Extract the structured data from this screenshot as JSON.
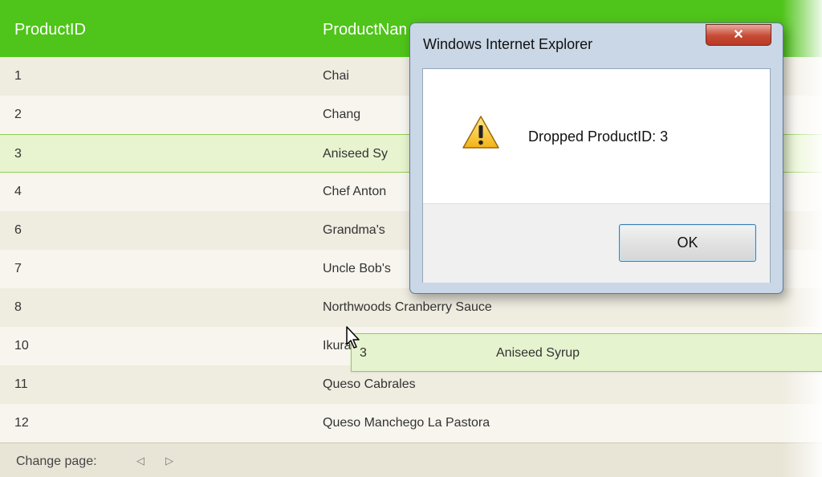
{
  "grid": {
    "columns": [
      "ProductID",
      "ProductName"
    ],
    "rows": [
      {
        "id": "1",
        "name": "Chai"
      },
      {
        "id": "2",
        "name": "Chang"
      },
      {
        "id": "3",
        "name": "Aniseed Sy"
      },
      {
        "id": "4",
        "name": "Chef Anton"
      },
      {
        "id": "6",
        "name": "Grandma's"
      },
      {
        "id": "7",
        "name": "Uncle Bob's"
      },
      {
        "id": "8",
        "name": "Northwoods Cranberry Sauce"
      },
      {
        "id": "10",
        "name": "Ikura"
      },
      {
        "id": "11",
        "name": "Queso Cabrales"
      },
      {
        "id": "12",
        "name": "Queso Manchego La Pastora"
      }
    ],
    "pager_label": "Change page:",
    "prev_glyph": "◁",
    "next_glyph": "▷"
  },
  "drag_ghost": {
    "id": "3",
    "name": "Aniseed Syrup"
  },
  "dialog": {
    "title": "Windows Internet Explorer",
    "close_glyph": "✕",
    "message": "Dropped ProductID: 3",
    "ok_label": "OK",
    "icon": "warning-icon"
  },
  "colors": {
    "header": "#4fc41a",
    "selected_row": "#e7f4cf",
    "row_odd": "#efece0",
    "row_even": "#f7f5ee"
  }
}
